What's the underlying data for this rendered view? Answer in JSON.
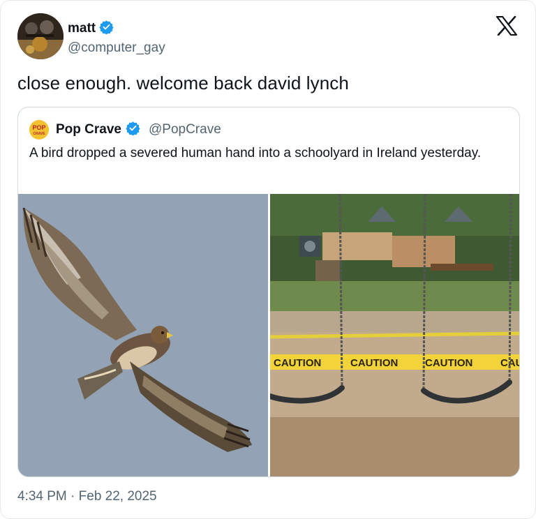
{
  "author": {
    "display_name": "matt",
    "handle": "@computer_gay",
    "verified": true
  },
  "tweet": {
    "text": "close enough. welcome back david lynch",
    "timestamp": "4:34 PM · Feb 22, 2025"
  },
  "quoted_tweet": {
    "display_name": "Pop Crave",
    "handle": "@PopCrave",
    "verified": true,
    "avatar_text_top": "POP",
    "avatar_text_bottom": "CRAVE",
    "text": "A bird dropped a severed human hand into a schoolyard in Ireland yesterday."
  },
  "media": {
    "caution_tape": [
      "CAUTION",
      "CAUTION",
      "CAUTION",
      "CAU"
    ]
  },
  "colors": {
    "verified_blue": "#1d9bf0",
    "secondary_text": "#536471",
    "primary_text": "#0f1419",
    "caution_yellow": "#f2d33a"
  },
  "icons": {
    "logo": "x-logo-icon",
    "verified": "verified-badge-icon"
  }
}
